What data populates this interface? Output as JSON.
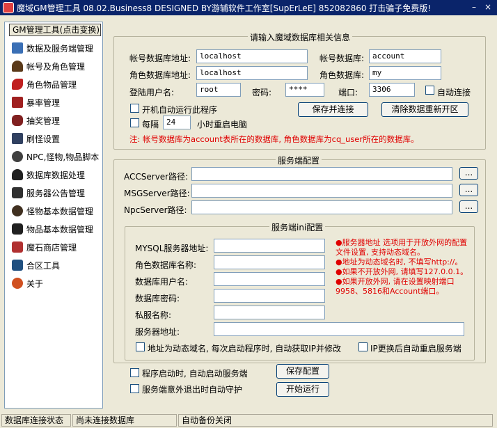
{
  "window": {
    "title": "魔域GM管理工具 08.02.Business8 DESIGNED BY游辅软件工作室[SupErLeE] 852082860  打击骗子免费版!",
    "min": "–",
    "close": "×"
  },
  "sidebar": {
    "header": "GM管理工具(点击变换)",
    "items": [
      {
        "label": "数据及服务端管理",
        "icon": "book-icon"
      },
      {
        "label": "帐号及角色管理",
        "icon": "character-icon"
      },
      {
        "label": "角色物品管理",
        "icon": "feather-icon"
      },
      {
        "label": "暴率管理",
        "icon": "card-icon"
      },
      {
        "label": "抽奖管理",
        "icon": "fist-icon"
      },
      {
        "label": "刷怪设置",
        "icon": "tower-icon"
      },
      {
        "label": "NPC,怪物,物品脚本",
        "icon": "npc-icon"
      },
      {
        "label": "数据库数据处理",
        "icon": "database-icon"
      },
      {
        "label": "服务器公告管理",
        "icon": "announcement-icon"
      },
      {
        "label": "怪物基本数据管理",
        "icon": "monster-icon"
      },
      {
        "label": "物品基本数据管理",
        "icon": "item-icon"
      },
      {
        "label": "魔石商店管理",
        "icon": "shop-icon"
      },
      {
        "label": "合区工具",
        "icon": "merge-icon"
      },
      {
        "label": "关于",
        "icon": "about-icon"
      }
    ]
  },
  "db_group": {
    "title": "请输入魔域数据库相关信息",
    "account_db_addr_label": "帐号数据库地址:",
    "account_db_addr": "localhost",
    "account_db_label": "帐号数据库:",
    "account_db": "account",
    "role_db_addr_label": "角色数据库地址:",
    "role_db_addr": "localhost",
    "role_db_label": "角色数据库:",
    "role_db": "my",
    "user_label": "登陆用户名:",
    "user": "root",
    "password_label": "密码:",
    "password": "****",
    "port_label": "端口:",
    "port": "3306",
    "auto_connect_label": "自动连接",
    "autorun_label": "开机自动运行此程序",
    "every_label": "每隔",
    "hours": "24",
    "hours_suffix": "小时重启电脑",
    "save_connect": "保存并连接",
    "clear_db": "清除数据重新开区",
    "note": "注: 帐号数据库为account表所在的数据库, 角色数据库为cq_user所在的数据库。"
  },
  "server_group": {
    "title": "服务端配置",
    "acc_label": "ACCServer路径:",
    "msg_label": "MSGServer路径:",
    "npc_label": "NpcServer路径:",
    "browse": "...",
    "ini_title": "服务端ini配置",
    "mysql_label": "MYSQL服务器地址:",
    "role_db_name_label": "角色数据库名称:",
    "db_user_label": "数据库用户名:",
    "db_pass_label": "数据库密码:",
    "private_name_label": "私服名称:",
    "server_addr_label": "服务器地址:",
    "tips": [
      "●服务器地址 选项用于开放外网的配置文件设置, 支持动态域名。",
      "●地址为动态域名时, 不填写http://。",
      "●如果不开放外网, 请填写127.0.0.1。",
      "●如果开放外网, 请在设置映射端口9958、5816和Account端口。"
    ],
    "dyn_domain_label": "地址为动态域名, 每次启动程序时, 自动获取IP并修改",
    "ip_restart_label": "IP更换后自动重启服务端"
  },
  "bottom": {
    "auto_start_label": "程序启动时, 自动启动服务端",
    "guard_label": "服务端意外退出时自动守护",
    "save_config": "保存配置",
    "start_run": "开始运行"
  },
  "status": {
    "db_state_label": "数据库连接状态",
    "db_state": "尚未连接数据库",
    "backup": "自动备份关闭"
  }
}
